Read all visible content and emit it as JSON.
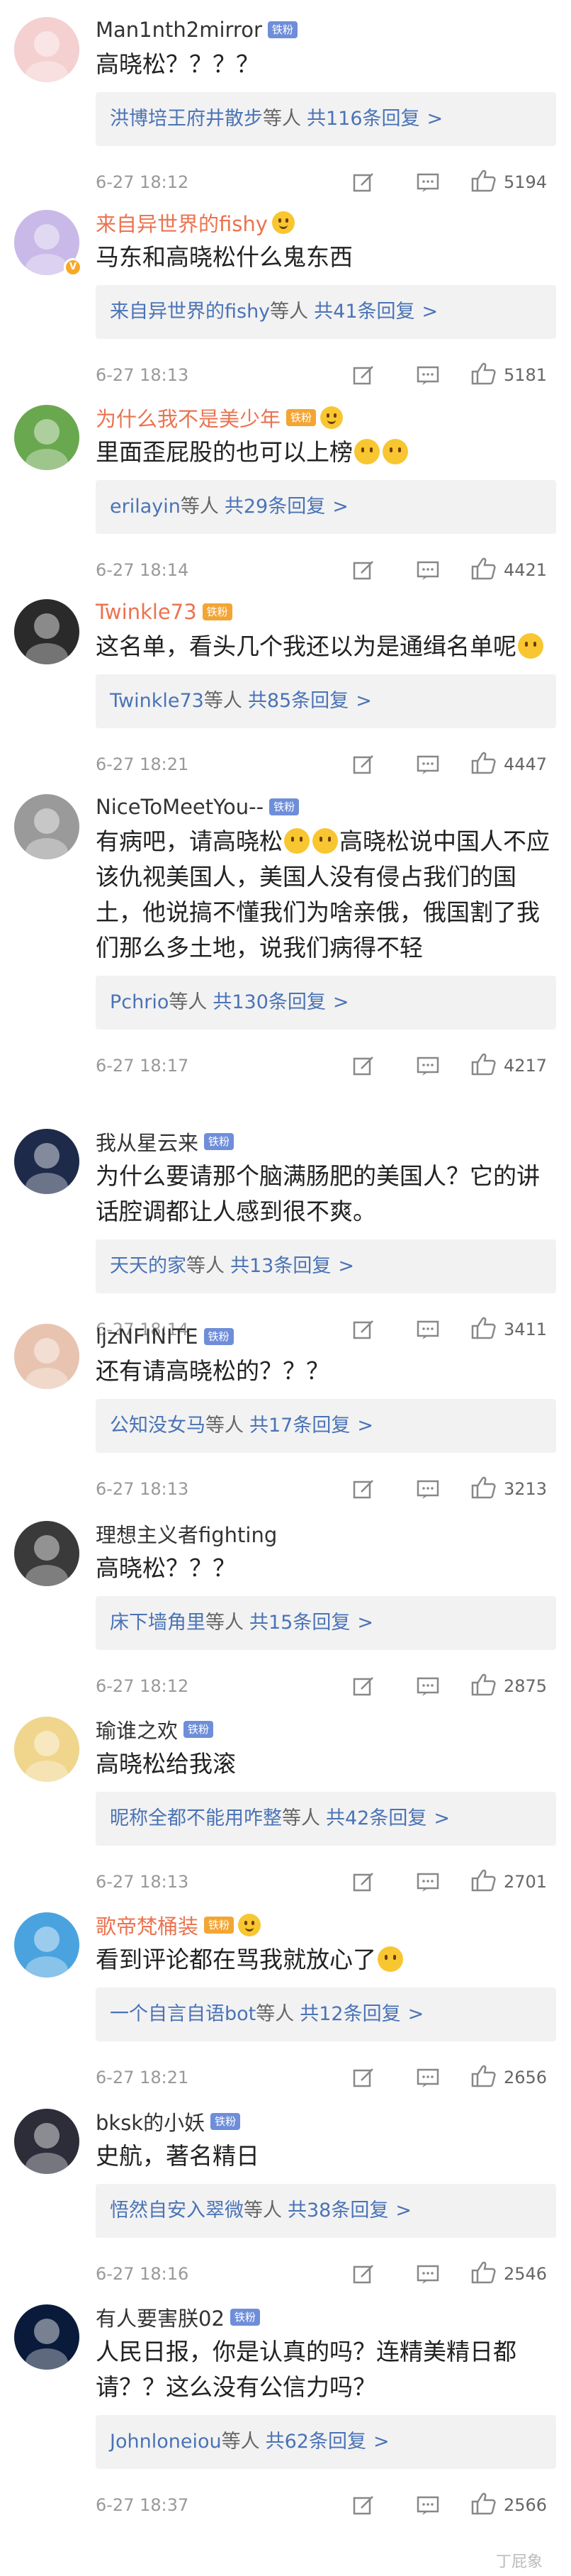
{
  "comments": [
    {
      "user": "Man1nth2mirror",
      "user_color": "#333333",
      "badge": "铁粉",
      "badge_style": "blue",
      "emoji_after_name": 0,
      "text": "高晓松？？？？",
      "reply_who": "洪博培王府井散步",
      "reply_etc": "等人",
      "reply_count": "共116条回复",
      "time": "6-27 18:12",
      "likes": "5194",
      "avatar_icon": "cartoon-girl-avatar",
      "verified": false
    },
    {
      "user": "来自异世界的fishy",
      "user_color": "#eb7350",
      "badge": "",
      "badge_style": "",
      "emoji_after_name": 1,
      "text": "马东和高晓松什么鬼东西",
      "reply_who": "来自异世界的fishy",
      "reply_etc": "等人",
      "reply_count": "共41条回复",
      "time": "6-27 18:13",
      "likes": "5181",
      "avatar_icon": "anime-avatar",
      "verified": true
    },
    {
      "user": "为什么我不是美少年",
      "user_color": "#eb7350",
      "badge": "铁粉",
      "badge_style": "gold",
      "emoji_after_name": 1,
      "text": "里面歪屁股的也可以上榜",
      "text_emojis": 2,
      "reply_who": "erilayin",
      "reply_etc": "等人",
      "reply_count": "共29条回复",
      "time": "6-27 18:14",
      "likes": "4421",
      "avatar_icon": "frog-avatar",
      "verified": false
    },
    {
      "user": "Twinkle73",
      "user_color": "#eb7350",
      "badge": "铁粉",
      "badge_style": "gold",
      "emoji_after_name": 0,
      "text": "这名单，看头几个我还以为是通缉名单呢",
      "text_emojis": 1,
      "reply_who": "Twinkle73",
      "reply_etc": "等人",
      "reply_count": "共85条回复",
      "time": "6-27 18:21",
      "likes": "4447",
      "avatar_icon": "panda-avatar",
      "verified": false
    },
    {
      "user": "NiceToMeetYou--",
      "user_color": "#333333",
      "badge": "铁粉",
      "badge_style": "blue",
      "emoji_after_name": 0,
      "text_parts": [
        "有病吧，请高晓松",
        "高晓松说中国人不应该仇视美国人，美国人没有侵占我们的国土，他说搞不懂我们为啥亲俄，俄国割了我们那么多土地，说我们病得不轻"
      ],
      "text_mid_emojis": 2,
      "reply_who": "Pchrio",
      "reply_etc": "等人",
      "reply_count": "共130条回复",
      "time": "6-27 18:17",
      "likes": "4217",
      "avatar_icon": "gray-portrait-avatar",
      "verified": false
    },
    {
      "user": "我从星云来",
      "user_color": "#333333",
      "badge": "铁粉",
      "badge_style": "blue",
      "emoji_after_name": 0,
      "text": "为什么要请那个脑满肠肥的美国人？它的讲话腔调都让人感到很不爽。",
      "reply_who": "天天的家",
      "reply_etc": "等人",
      "reply_count": "共13条回复",
      "time": "6-27 18:14",
      "likes": "3411",
      "avatar_icon": "night-sky-avatar",
      "verified": false
    },
    {
      "user": "ljzNFINITE",
      "user_color": "#333333",
      "badge": "铁粉",
      "badge_style": "blue",
      "emoji_after_name": 0,
      "text": "还有请高晓松的？？？",
      "reply_who": "公知没女马",
      "reply_etc": "等人",
      "reply_count": "共17条回复",
      "time": "6-27 18:13",
      "likes": "3213",
      "avatar_icon": "girl-photo-avatar",
      "verified": false
    },
    {
      "user": "理想主义者fighting",
      "user_color": "#333333",
      "badge": "",
      "badge_style": "",
      "emoji_after_name": 0,
      "text": "高晓松？？？",
      "reply_who": "床下墙角里",
      "reply_etc": "等人",
      "reply_count": "共15条回复",
      "time": "6-27 18:12",
      "likes": "2875",
      "avatar_icon": "boy-photo-avatar",
      "verified": false
    },
    {
      "user": "瑜谁之欢",
      "user_color": "#333333",
      "badge": "铁粉",
      "badge_style": "blue",
      "emoji_after_name": 0,
      "text": "高晓松给我滚",
      "reply_who": "昵称全都不能用咋整",
      "reply_etc": "等人",
      "reply_count": "共42条回复",
      "time": "6-27 18:13",
      "likes": "2701",
      "avatar_icon": "cartoon-elder-avatar",
      "verified": false
    },
    {
      "user": "歌帝梵桶装",
      "user_color": "#eb7350",
      "badge": "铁粉",
      "badge_style": "gold",
      "emoji_after_name": 1,
      "text": "看到评论都在骂我就放心了",
      "text_emojis": 1,
      "reply_who": "一个自言自语bot",
      "reply_etc": "等人",
      "reply_count": "共12条回复",
      "time": "6-27 18:21",
      "likes": "2656",
      "avatar_icon": "doraemon-avatar",
      "verified": false
    },
    {
      "user": "bksk的小妖",
      "user_color": "#333333",
      "badge": "铁粉",
      "badge_style": "blue",
      "emoji_after_name": 0,
      "text": "史航，著名精日",
      "reply_who": "悟然自安入翠微",
      "reply_etc": "等人",
      "reply_count": "共38条回复",
      "time": "6-27 18:16",
      "likes": "2546",
      "avatar_icon": "cat-avatar",
      "verified": false
    },
    {
      "user": "有人要害朕02",
      "user_color": "#333333",
      "badge": "铁粉",
      "badge_style": "blue",
      "emoji_after_name": 0,
      "text": "人民日报，你是认真的吗？连精美精日都请？？这么没有公信力吗？",
      "reply_who": "Johnloneiou",
      "reply_etc": "等人",
      "reply_count": "共62条回复",
      "time": "6-27 18:37",
      "likes": "2566",
      "avatar_icon": "space-avatar",
      "verified": false
    }
  ],
  "icons": {
    "edit": "edit-icon",
    "comment": "comment-icon",
    "like": "like-icon",
    "reply_chevron": ">"
  },
  "watermark": "丁屁象",
  "colors": {
    "link": "#4a73b6",
    "orange_name": "#eb7350",
    "reply_bg": "#f2f2f2",
    "badge_blue": "#6f8ed9",
    "badge_gold": "#f3a533"
  }
}
